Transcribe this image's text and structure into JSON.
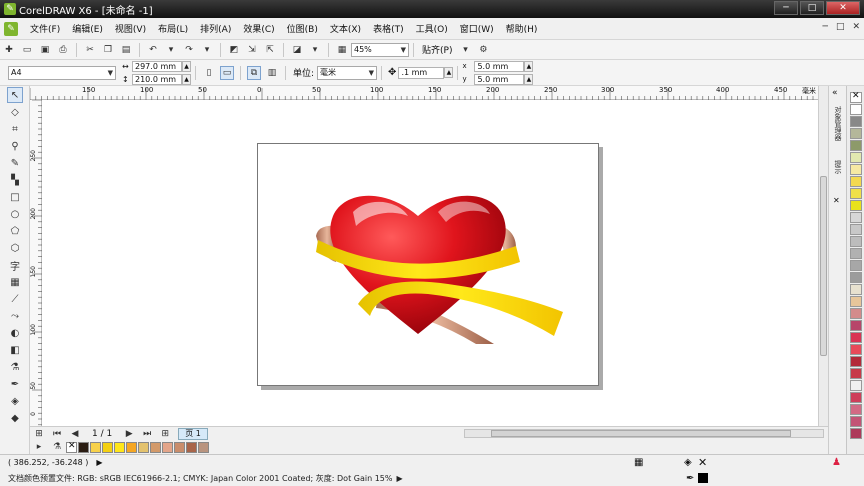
{
  "window": {
    "title": "CorelDRAW X6 - [未命名 -1]",
    "minimize": "─",
    "maximize": "□",
    "close": "✕"
  },
  "menu": {
    "items": [
      "文件(F)",
      "编辑(E)",
      "视图(V)",
      "布局(L)",
      "排列(A)",
      "效果(C)",
      "位图(B)",
      "文本(X)",
      "表格(T)",
      "工具(O)",
      "窗口(W)",
      "帮助(H)"
    ],
    "right": [
      "─",
      "□",
      "✕"
    ]
  },
  "standard_toolbar": {
    "zoom": "45%",
    "snap_label": "贴齐(P)"
  },
  "property_bar": {
    "page_size": "A4",
    "width": "297.0 mm",
    "height": "210.0 mm",
    "units_label": "单位:",
    "units": "毫米",
    "nudge": ".1 mm",
    "dup_x": "5.0 mm",
    "dup_y": "5.0 mm",
    "dup_x_label": "x",
    "dup_y_label": "y"
  },
  "hruler": {
    "ticks": [
      "150",
      "100",
      "50",
      "0",
      "50",
      "100",
      "150",
      "200",
      "250",
      "300",
      "350",
      "400",
      "450"
    ],
    "unit": "毫米"
  },
  "vruler": {
    "ticks": [
      "250",
      "200",
      "150",
      "100",
      "50",
      "0"
    ]
  },
  "page_nav": {
    "counter": "1 / 1",
    "tab": "页 1"
  },
  "dock": {
    "tab1": "对象管理器",
    "tab2": "提示"
  },
  "status": {
    "coords": "( 386.252, -36.248 )",
    "color_profile": "文档颜色预置文件: RGB: sRGB IEC61966-2.1; CMYK: Japan Color 2001 Coated; 灰度: Dot Gain 15%"
  },
  "colors": {
    "doc_palette": [
      "#2b1d12",
      "#f7d14a",
      "#f4d011",
      "#ffe61a",
      "#f5a623",
      "#e3c26e",
      "#d39a6a",
      "#e3a58a",
      "#c98d6c",
      "#a8654a",
      "#b9947f"
    ],
    "palette": [
      "#ffffff",
      "#888888",
      "#b4b79a",
      "#8d9a6a",
      "#e2e9b0",
      "#f6e9a3",
      "#f4d94f",
      "#f0e04a",
      "#e8e21c",
      "#d7d7d7",
      "#c8c8c8",
      "#bcbcbc",
      "#b1b1b1",
      "#a7a7a7",
      "#9c9c9c",
      "#e7e1cf",
      "#e7c69a",
      "#d38b8b",
      "#b7466a",
      "#d93454",
      "#e84a59",
      "#b32a39",
      "#c73a48",
      "#f0f0f0",
      "#ce3f5a",
      "#d26a84",
      "#c35475",
      "#ad3a5a",
      "#d04d68",
      "#f0c8d8"
    ]
  }
}
